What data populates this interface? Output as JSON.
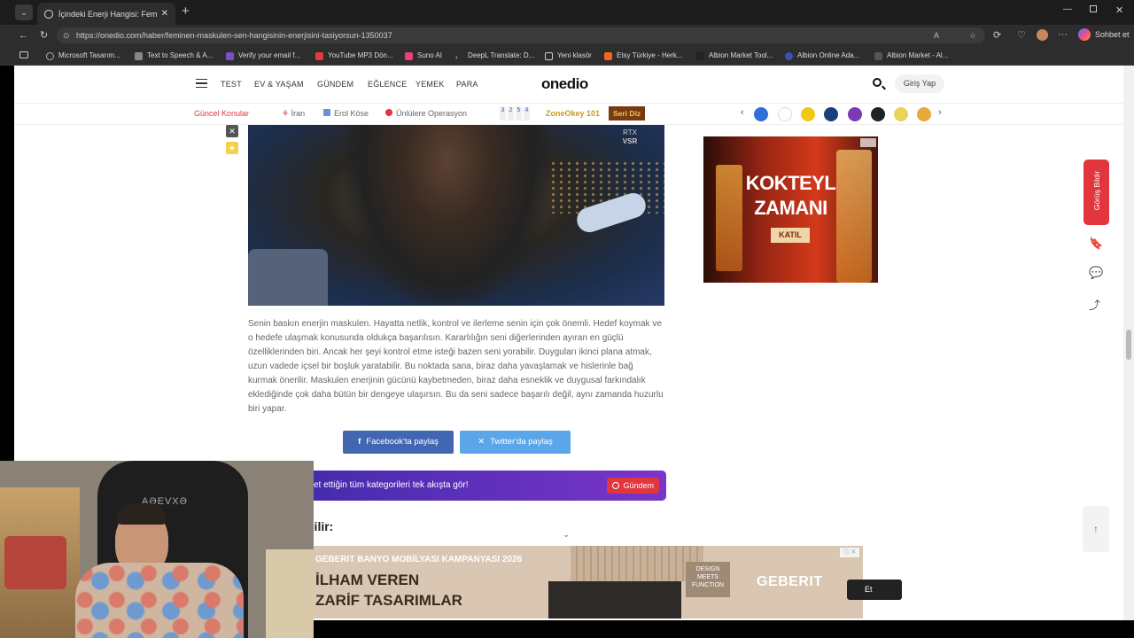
{
  "browser": {
    "tab_title": "İçindeki Enerji Hangisi: Feminen m",
    "url": "https://onedio.com/haber/feminen-maskulen-sen-hangisinin-enerjisini-tasiyorsun-1350037",
    "chat_label": "Sohbet et",
    "bookmarks": [
      "Microsoft Tasarım...",
      "Text to Speech & A...",
      "Verify your email f...",
      "YouTube MP3 Dön...",
      "Suno AI",
      "DeepL Translate: D...",
      "Yeni klasör",
      "Etsy Türkiye - Herk...",
      "Albion Market Tool...",
      "Albion Online Ada...",
      "Albion Market - Al..."
    ]
  },
  "site": {
    "logo": "onedio",
    "nav": [
      "TEST",
      "EV & YAŞAM",
      "GÜNDEM",
      "EĞLENCE",
      "YEMEK",
      "PARA"
    ],
    "login": "Giriş Yap",
    "topics_label": "Güncel Konular",
    "topics": [
      "İran",
      "Erol Köse",
      "Ünlülere Operasyon"
    ],
    "zone_digits": [
      "3",
      "2",
      "5",
      "4"
    ],
    "zone_label": "ZoneOkey 101",
    "series_label": "Seri Diz"
  },
  "media": {
    "badge_line1": "RTX",
    "badge_line2": "VSR"
  },
  "article": {
    "paragraph": "Senin baskın enerjin maskulen. Hayatta netlik, kontrol ve ilerleme senin için çok önemli. Hedef koymak ve o hedefe ulaşmak konusunda oldukça başarılısın. Kararlılığın seni diğerlerinden ayıran en güçlü özelliklerinden biri. Ancak her şeyi kontrol etme isteği bazen seni yorabilir. Duyguları ikinci plana atmak, uzun vadede içsel bir boşluk yaratabilir. Bu noktada sana, biraz daha yavaşlamak ve hislerinle bağ kurmak önerilir. Maskulen enerjinin gücünü kaybetmeden, biraz daha esneklik ve duygusal farkındalık eklediğinde çok daha bütün bir dengeye ulaşırsın. Bu da seni sadece başarılı değil, aynı zamanda huzurlu biri yapar.",
    "share_facebook": "Facebook'ta paylaş",
    "share_twitter": "Twitter'da paylaş",
    "promo_text": "et ettiğin tüm kategorileri tek akışta gör!",
    "promo_button": "Gündem",
    "next_heading": "bilir:"
  },
  "side_ad": {
    "line1": "KOKTEYL",
    "line2": "ZAMANI",
    "button": "KATIL"
  },
  "feedback_label": "Görüş Bildir",
  "bottom_ad": {
    "top_line": "GEBERIT BANYO MOBİLYASI KAMPANYASI 2026",
    "line1": "İLHAM VEREN",
    "line2": "ZARİF TASARIMLAR",
    "tag_line1": "DESIGN",
    "tag_line2": "MEETS",
    "tag_line3": "FUNCTION",
    "brand": "GEBERIT",
    "button_fragment": "Et"
  },
  "webcam": {
    "chair_brand": "AƏEVXƏ"
  },
  "colors": {
    "accent_red": "#e2353e",
    "facebook": "#4267b2",
    "twitter": "#5aa6e8",
    "promo_purple": "#5b2fc0"
  }
}
